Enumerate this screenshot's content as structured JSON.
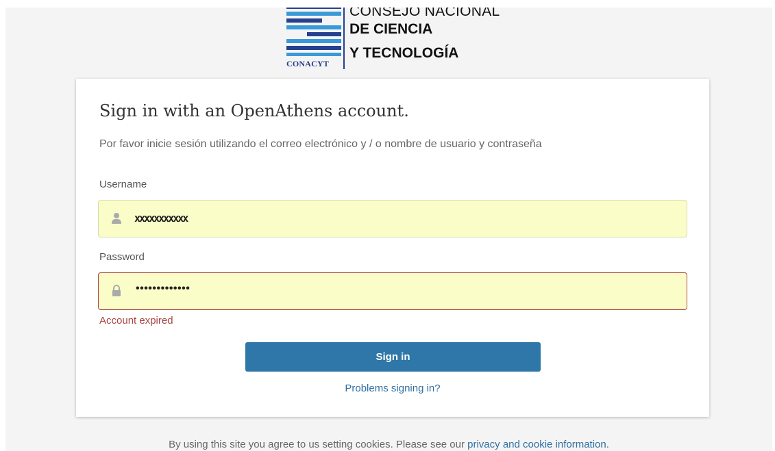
{
  "logo": {
    "line1": "CONSEJO NACIONAL",
    "line2": "DE CIENCIA",
    "line3": "Y TECNOLOGÍA",
    "abbrev": "CONACYT",
    "color": "#24408e",
    "accent": "#3a9ad9"
  },
  "login": {
    "title": "Sign in with an OpenAthens account.",
    "subtitle": "Por favor inicie sesión utilizando el correo electrónico y / o nombre de usuario y contraseña",
    "username_label": "Username",
    "username_value": "xxxxxxxxxxx",
    "password_label": "Password",
    "password_value": "•••••••••••••",
    "error": "Account expired",
    "signin_label": "Sign in",
    "problems_link": "Problems signing in?"
  },
  "footer": {
    "text": "By using this site you agree to us setting cookies. Please see our ",
    "link": "privacy and cookie information",
    "end": "."
  },
  "colors": {
    "field_bg": "#fafdc7",
    "error": "#a94442",
    "button": "#2f77a8",
    "link": "#2f6fa3"
  },
  "icons": {
    "username": "user-icon",
    "password": "lock-icon"
  }
}
